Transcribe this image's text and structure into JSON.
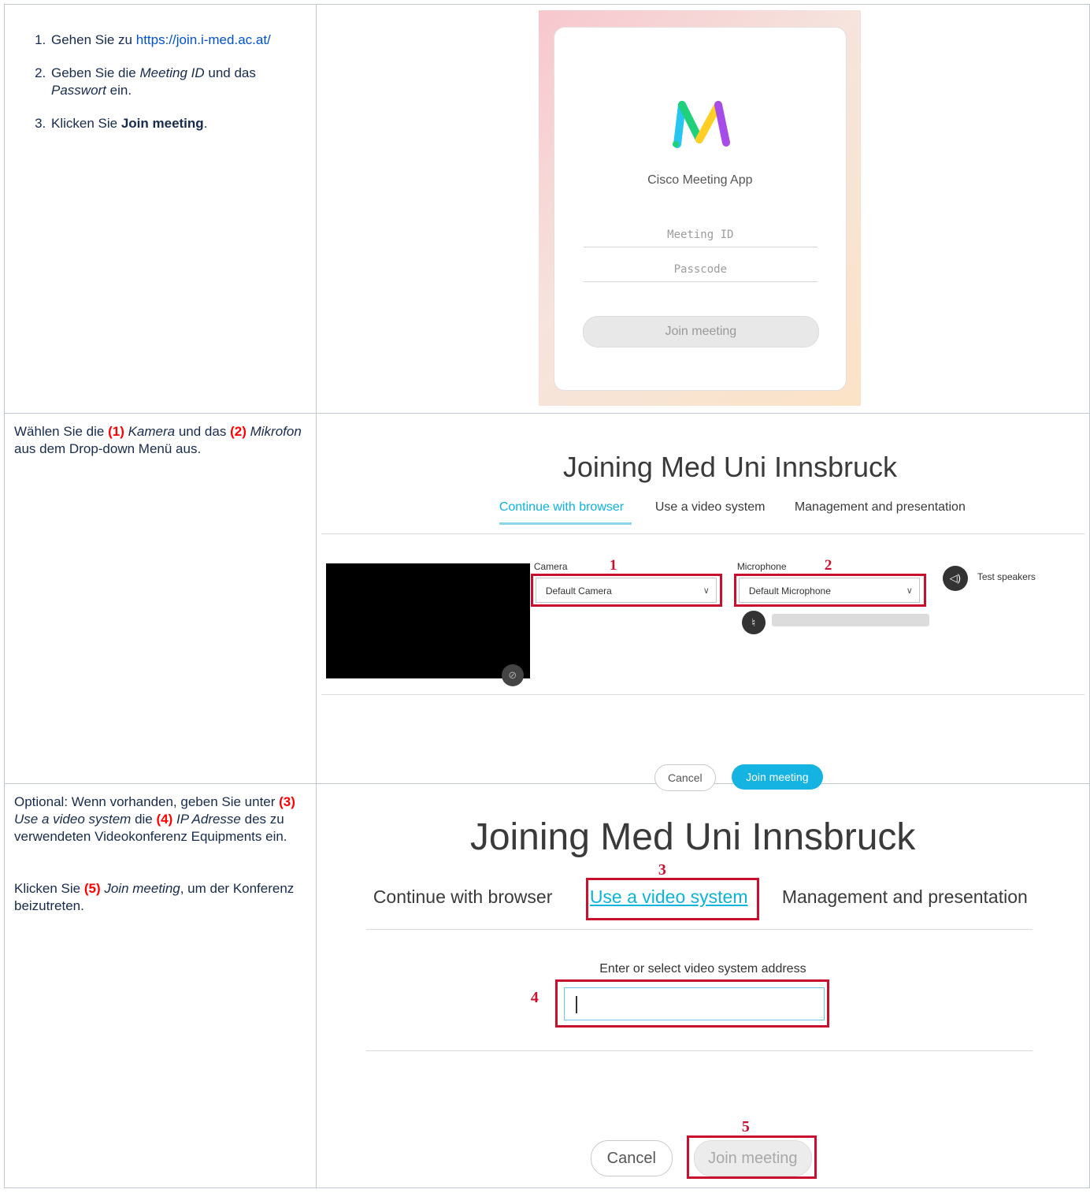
{
  "step1": {
    "items": [
      {
        "pre": "Gehen Sie zu ",
        "link": "https://join.i-med.ac.at/"
      },
      {
        "pre": "Geben Sie die ",
        "em1": "Meeting ID",
        "mid": " und das ",
        "em2": "Passwort",
        "post": " ein."
      },
      {
        "pre": "Klicken Sie ",
        "strong": "Join meeting",
        "post": "."
      }
    ],
    "screenshot": {
      "app_name": "Cisco Meeting App",
      "meeting_id_placeholder": "Meeting ID",
      "passcode_placeholder": "Passcode",
      "join_button": "Join meeting",
      "logo_colors": [
        "#28c5f0",
        "#1fd17a",
        "#ffcf26",
        "#a64ce8"
      ]
    }
  },
  "step2": {
    "text": {
      "a": "Wählen Sie die ",
      "n1": "(1)",
      "e1": "Kamera",
      "b": " und das ",
      "n2": "(2)",
      "e2": "Mikrofon",
      "c": " aus dem Drop-down Menü aus."
    },
    "screenshot": {
      "title": "Joining Med Uni Innsbruck",
      "tabs": [
        "Continue with browser",
        "Use a video system",
        "Management and presentation"
      ],
      "active_tab": 0,
      "camera_label": "Camera",
      "camera_value": "Default Camera",
      "microphone_label": "Microphone",
      "microphone_value": "Default Microphone",
      "test_speakers": "Test speakers",
      "marker1": "1",
      "marker2": "2",
      "cancel": "Cancel",
      "join": "Join meeting"
    }
  },
  "step3": {
    "p1": {
      "a": "Optional: Wenn vorhanden, geben Sie unter ",
      "n3": "(3)",
      "e3": "Use a video system",
      "b": " die ",
      "n4": "(4)",
      "e4": "IP Adresse",
      "c": " des zu verwendeten Videokonferenz Equipments ein."
    },
    "p2": {
      "a": "Klicken Sie ",
      "n5": "(5)",
      "e5": "Join meeting",
      "b": ", um der Konferenz beizutreten."
    },
    "screenshot": {
      "title": "Joining Med Uni Innsbruck",
      "tabs": [
        "Continue with browser",
        "Use a video system",
        "Management and presentation"
      ],
      "active_tab": 1,
      "address_label": "Enter or select video system address",
      "marker3": "3",
      "marker4": "4",
      "marker5": "5",
      "cancel": "Cancel",
      "join": "Join meeting"
    }
  },
  "colors": {
    "link": "#0052cc",
    "annotation": "#c8102e",
    "accent": "#0cb3db",
    "join_blue": "#15b3e2"
  }
}
